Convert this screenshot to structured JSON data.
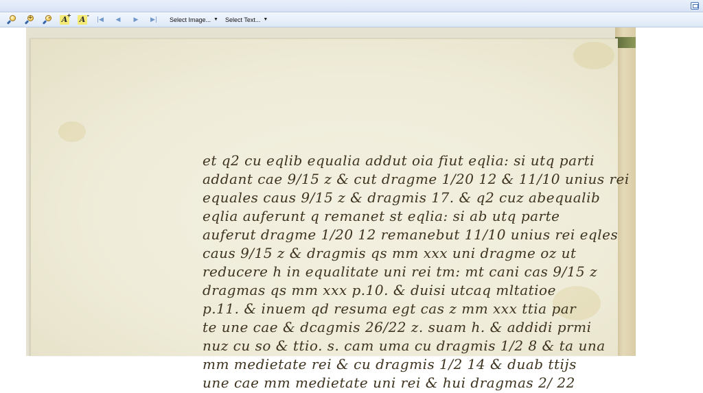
{
  "toolbar": {
    "buttons": [
      {
        "name": "zoom-fit-icon",
        "sign": ""
      },
      {
        "name": "zoom-in-icon",
        "sign": "+"
      },
      {
        "name": "zoom-out-icon",
        "sign": "-"
      },
      {
        "name": "font-larger-icon",
        "sign": "+"
      },
      {
        "name": "font-smaller-icon",
        "sign": "-"
      }
    ],
    "nav": {
      "first": "first-page-icon",
      "prev": "prev-page-icon",
      "next": "next-page-icon",
      "last": "last-page-icon"
    },
    "select_image_label": "Select Image...",
    "select_text_label": "Select Text..."
  },
  "window": {
    "restore_icon": "restore-window-icon"
  },
  "document": {
    "manuscript_lines": [
      "et q2 cu eqlib equalia addut oia fiut eqlia: si utq parti",
      "addant cae 9/15 z & cut dragme 1/20 12 & 11/10 unius rei",
      "equales caus 9/15 z & dragmis 17. & q2 cuz abequalib",
      "eqlia auferunt q remanet st eqlia: si ab utq parte",
      "auferut dragme 1/20 12 remanebut 11/10 unius rei eqles",
      "caus 9/15 z & dragmis qs mm xxx uni dragme oz ut",
      "reducere h in equalitate uni rei tm: mt cani cas 9/15 z",
      "dragmas qs mm xxx p.10. & duisi utcaq mltatioe",
      "p.11. & inuem qd resuma egt cas z mm xxx ttia par",
      "te une cae & dcagmis 26/22 z. suam h. & addidi prmi",
      "nuz cu so & ttio. s. cam uma cu dragmis 1/2 8 & ta una",
      "mm medietate rei & cu dragmis 1/2 14 & duab ttijs",
      "une cae mm medietate uni rei & hui dragmas 2/ 22"
    ]
  }
}
